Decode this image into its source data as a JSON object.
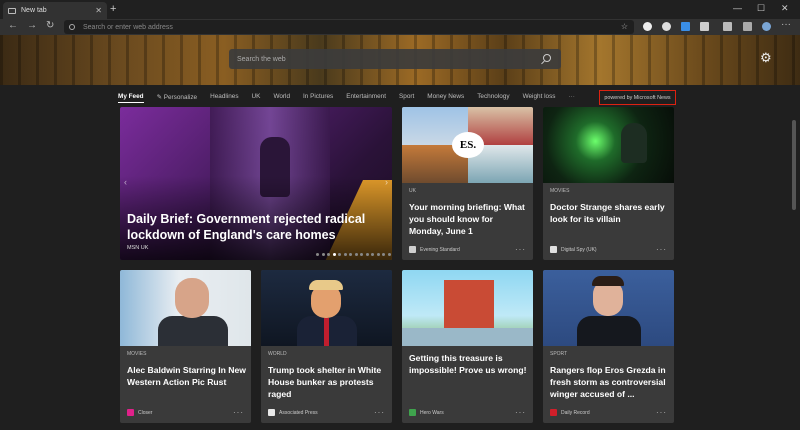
{
  "browser": {
    "tab_title": "New tab",
    "tab_close": "✕",
    "new_tab": "+",
    "address_placeholder": "Search or enter web address",
    "window_controls": [
      "—",
      "☐",
      "✕"
    ],
    "nav": {
      "back": "←",
      "forward": "→",
      "refresh": "↻"
    }
  },
  "hero": {
    "search_placeholder": "Search the web",
    "settings_icon": "gear-icon"
  },
  "categories": {
    "items": [
      "My Feed",
      "Personalize",
      "Headlines",
      "UK",
      "World",
      "In Pictures",
      "Entertainment",
      "Sport",
      "Money News",
      "Technology",
      "Weight loss"
    ],
    "more": "···",
    "powered_by": "powered by Microsoft News"
  },
  "main_story": {
    "headline": "Daily Brief: Government rejected radical lockdown of England's care homes",
    "source": "MSN UK",
    "slide_count": 20,
    "active_slide": 3
  },
  "cards": [
    {
      "category": "UK",
      "title": "Your morning briefing: What you should know for Monday, June 1",
      "source": "Evening Standard",
      "logo_color": "#cfcfcf",
      "image": "collage"
    },
    {
      "category": "Movies",
      "title": "Doctor Strange shares early look for its villain",
      "source": "Digital Spy (UK)",
      "logo_color": "#e0e0e0",
      "image": "strange"
    },
    {
      "category": "Movies",
      "title": "Alec Baldwin Starring In New Western Action Pic Rust",
      "source": "Closer",
      "logo_color": "#e0218a",
      "image": "baldwin"
    },
    {
      "category": "World",
      "title": "Trump took shelter in White House bunker as protests raged",
      "source": "Associated Press",
      "logo_color": "#e8e8e8",
      "image": "trump"
    },
    {
      "category": "",
      "title": "Getting this treasure is impossible! Prove us wrong!",
      "source": "Hero Wars",
      "logo_color": "#3fa34d",
      "image": "game"
    },
    {
      "category": "Sport",
      "title": "Rangers flop Eros Grezda in fresh storm as controversial winger accused of ...",
      "source": "Daily Record",
      "logo_color": "#d11f2a",
      "image": "rangers"
    }
  ],
  "card_more": "···"
}
